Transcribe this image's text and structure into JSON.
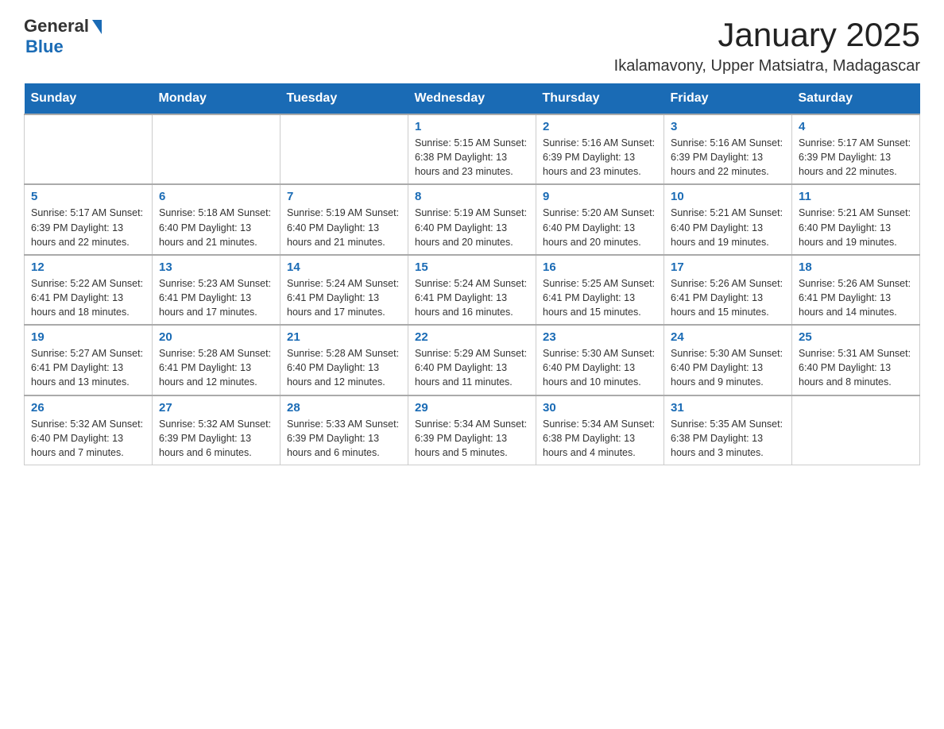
{
  "header": {
    "logo_general": "General",
    "logo_blue": "Blue",
    "month_title": "January 2025",
    "location": "Ikalamavony, Upper Matsiatra, Madagascar"
  },
  "days_of_week": [
    "Sunday",
    "Monday",
    "Tuesday",
    "Wednesday",
    "Thursday",
    "Friday",
    "Saturday"
  ],
  "weeks": [
    [
      {
        "day": "",
        "info": ""
      },
      {
        "day": "",
        "info": ""
      },
      {
        "day": "",
        "info": ""
      },
      {
        "day": "1",
        "info": "Sunrise: 5:15 AM\nSunset: 6:38 PM\nDaylight: 13 hours and 23 minutes."
      },
      {
        "day": "2",
        "info": "Sunrise: 5:16 AM\nSunset: 6:39 PM\nDaylight: 13 hours and 23 minutes."
      },
      {
        "day": "3",
        "info": "Sunrise: 5:16 AM\nSunset: 6:39 PM\nDaylight: 13 hours and 22 minutes."
      },
      {
        "day": "4",
        "info": "Sunrise: 5:17 AM\nSunset: 6:39 PM\nDaylight: 13 hours and 22 minutes."
      }
    ],
    [
      {
        "day": "5",
        "info": "Sunrise: 5:17 AM\nSunset: 6:39 PM\nDaylight: 13 hours and 22 minutes."
      },
      {
        "day": "6",
        "info": "Sunrise: 5:18 AM\nSunset: 6:40 PM\nDaylight: 13 hours and 21 minutes."
      },
      {
        "day": "7",
        "info": "Sunrise: 5:19 AM\nSunset: 6:40 PM\nDaylight: 13 hours and 21 minutes."
      },
      {
        "day": "8",
        "info": "Sunrise: 5:19 AM\nSunset: 6:40 PM\nDaylight: 13 hours and 20 minutes."
      },
      {
        "day": "9",
        "info": "Sunrise: 5:20 AM\nSunset: 6:40 PM\nDaylight: 13 hours and 20 minutes."
      },
      {
        "day": "10",
        "info": "Sunrise: 5:21 AM\nSunset: 6:40 PM\nDaylight: 13 hours and 19 minutes."
      },
      {
        "day": "11",
        "info": "Sunrise: 5:21 AM\nSunset: 6:40 PM\nDaylight: 13 hours and 19 minutes."
      }
    ],
    [
      {
        "day": "12",
        "info": "Sunrise: 5:22 AM\nSunset: 6:41 PM\nDaylight: 13 hours and 18 minutes."
      },
      {
        "day": "13",
        "info": "Sunrise: 5:23 AM\nSunset: 6:41 PM\nDaylight: 13 hours and 17 minutes."
      },
      {
        "day": "14",
        "info": "Sunrise: 5:24 AM\nSunset: 6:41 PM\nDaylight: 13 hours and 17 minutes."
      },
      {
        "day": "15",
        "info": "Sunrise: 5:24 AM\nSunset: 6:41 PM\nDaylight: 13 hours and 16 minutes."
      },
      {
        "day": "16",
        "info": "Sunrise: 5:25 AM\nSunset: 6:41 PM\nDaylight: 13 hours and 15 minutes."
      },
      {
        "day": "17",
        "info": "Sunrise: 5:26 AM\nSunset: 6:41 PM\nDaylight: 13 hours and 15 minutes."
      },
      {
        "day": "18",
        "info": "Sunrise: 5:26 AM\nSunset: 6:41 PM\nDaylight: 13 hours and 14 minutes."
      }
    ],
    [
      {
        "day": "19",
        "info": "Sunrise: 5:27 AM\nSunset: 6:41 PM\nDaylight: 13 hours and 13 minutes."
      },
      {
        "day": "20",
        "info": "Sunrise: 5:28 AM\nSunset: 6:41 PM\nDaylight: 13 hours and 12 minutes."
      },
      {
        "day": "21",
        "info": "Sunrise: 5:28 AM\nSunset: 6:40 PM\nDaylight: 13 hours and 12 minutes."
      },
      {
        "day": "22",
        "info": "Sunrise: 5:29 AM\nSunset: 6:40 PM\nDaylight: 13 hours and 11 minutes."
      },
      {
        "day": "23",
        "info": "Sunrise: 5:30 AM\nSunset: 6:40 PM\nDaylight: 13 hours and 10 minutes."
      },
      {
        "day": "24",
        "info": "Sunrise: 5:30 AM\nSunset: 6:40 PM\nDaylight: 13 hours and 9 minutes."
      },
      {
        "day": "25",
        "info": "Sunrise: 5:31 AM\nSunset: 6:40 PM\nDaylight: 13 hours and 8 minutes."
      }
    ],
    [
      {
        "day": "26",
        "info": "Sunrise: 5:32 AM\nSunset: 6:40 PM\nDaylight: 13 hours and 7 minutes."
      },
      {
        "day": "27",
        "info": "Sunrise: 5:32 AM\nSunset: 6:39 PM\nDaylight: 13 hours and 6 minutes."
      },
      {
        "day": "28",
        "info": "Sunrise: 5:33 AM\nSunset: 6:39 PM\nDaylight: 13 hours and 6 minutes."
      },
      {
        "day": "29",
        "info": "Sunrise: 5:34 AM\nSunset: 6:39 PM\nDaylight: 13 hours and 5 minutes."
      },
      {
        "day": "30",
        "info": "Sunrise: 5:34 AM\nSunset: 6:38 PM\nDaylight: 13 hours and 4 minutes."
      },
      {
        "day": "31",
        "info": "Sunrise: 5:35 AM\nSunset: 6:38 PM\nDaylight: 13 hours and 3 minutes."
      },
      {
        "day": "",
        "info": ""
      }
    ]
  ]
}
